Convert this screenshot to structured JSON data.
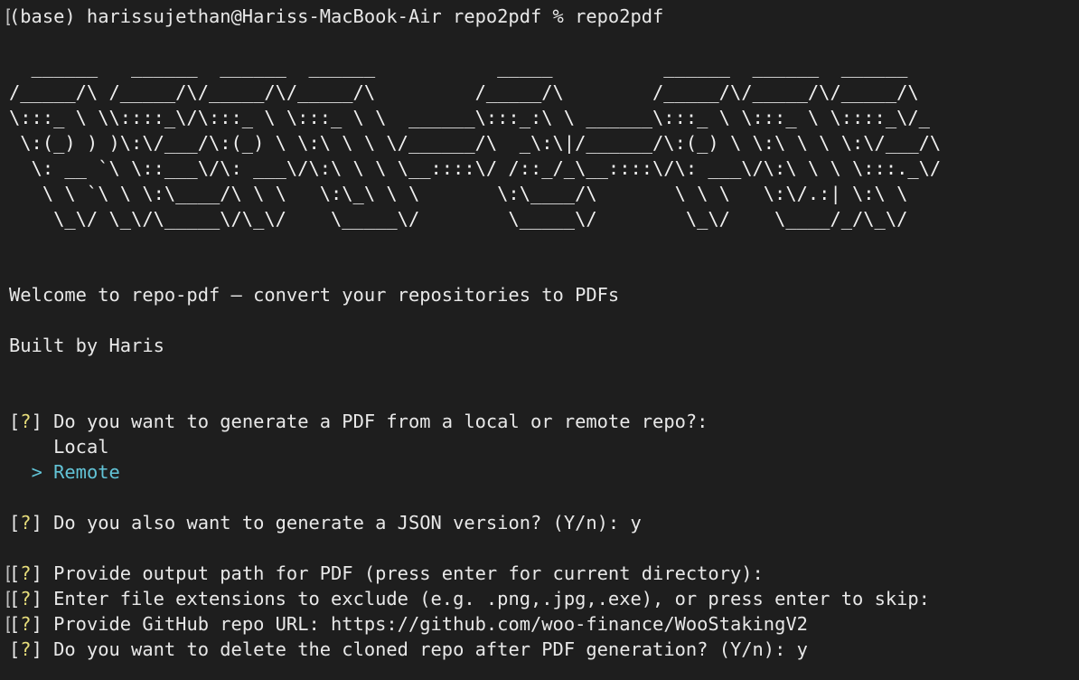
{
  "prompt": "(base) harissujethan@Hariss-MacBook-Air repo2pdf % repo2pdf",
  "banner": [
    "  ______   ______  ______  ______           _____          ______  ______  ______",
    "/_____/\\ /_____/\\/_____/\\/_____/\\         /_____/\\        /_____/\\/_____/\\/_____/\\",
    "\\:::_ \\ \\\\::::_\\/\\:::_ \\ \\:::_ \\ \\  ______\\:::_:\\ \\ ______\\:::_ \\ \\:::_ \\ \\::::_\\/_",
    " \\:(_) ) )\\:\\/___/\\:(_) \\ \\:\\ \\ \\ \\/______/\\  _\\:\\|/______/\\:(_) \\ \\:\\ \\ \\ \\:\\/___/\\",
    "  \\: __ `\\ \\::___\\/\\: ___\\/\\:\\ \\ \\ \\__::::\\/ /::_/_\\__::::\\/\\: ___\\/\\:\\ \\ \\ \\:::._\\/",
    "   \\ \\ `\\ \\ \\:\\____/\\ \\ \\   \\:\\_\\ \\ \\       \\:\\____/\\       \\ \\ \\   \\:\\/.:| \\:\\ \\",
    "    \\_\\/ \\_\\/\\_____\\/\\_\\/    \\_____\\/        \\_____\\/        \\_\\/    \\____/_/\\_\\/"
  ],
  "welcome": "Welcome to repo-pdf — convert your repositories to PDFs",
  "built_by": "Built by Haris",
  "q_mark": "?",
  "question_source": "Do you want to generate a PDF from a local or remote repo?:",
  "options": {
    "local": "Local",
    "remote": "Remote",
    "pointer": ">"
  },
  "question_json": "Do you also want to generate a JSON version? (Y/n): y",
  "question_output": "Provide output path for PDF (press enter for current directory):",
  "question_exclude": "Enter file extensions to exclude (e.g. .png,.jpg,.exe), or press enter to skip:",
  "question_repo_url": "Provide GitHub repo URL: https://github.com/woo-finance/WooStakingV2",
  "question_delete": "Do you want to delete the cloned repo after PDF generation? (Y/n): y",
  "colors": {
    "background": "#1e1e1e",
    "text": "#e8e8e8",
    "question_mark": "#e7dd7b",
    "selection": "#62c3d6"
  }
}
